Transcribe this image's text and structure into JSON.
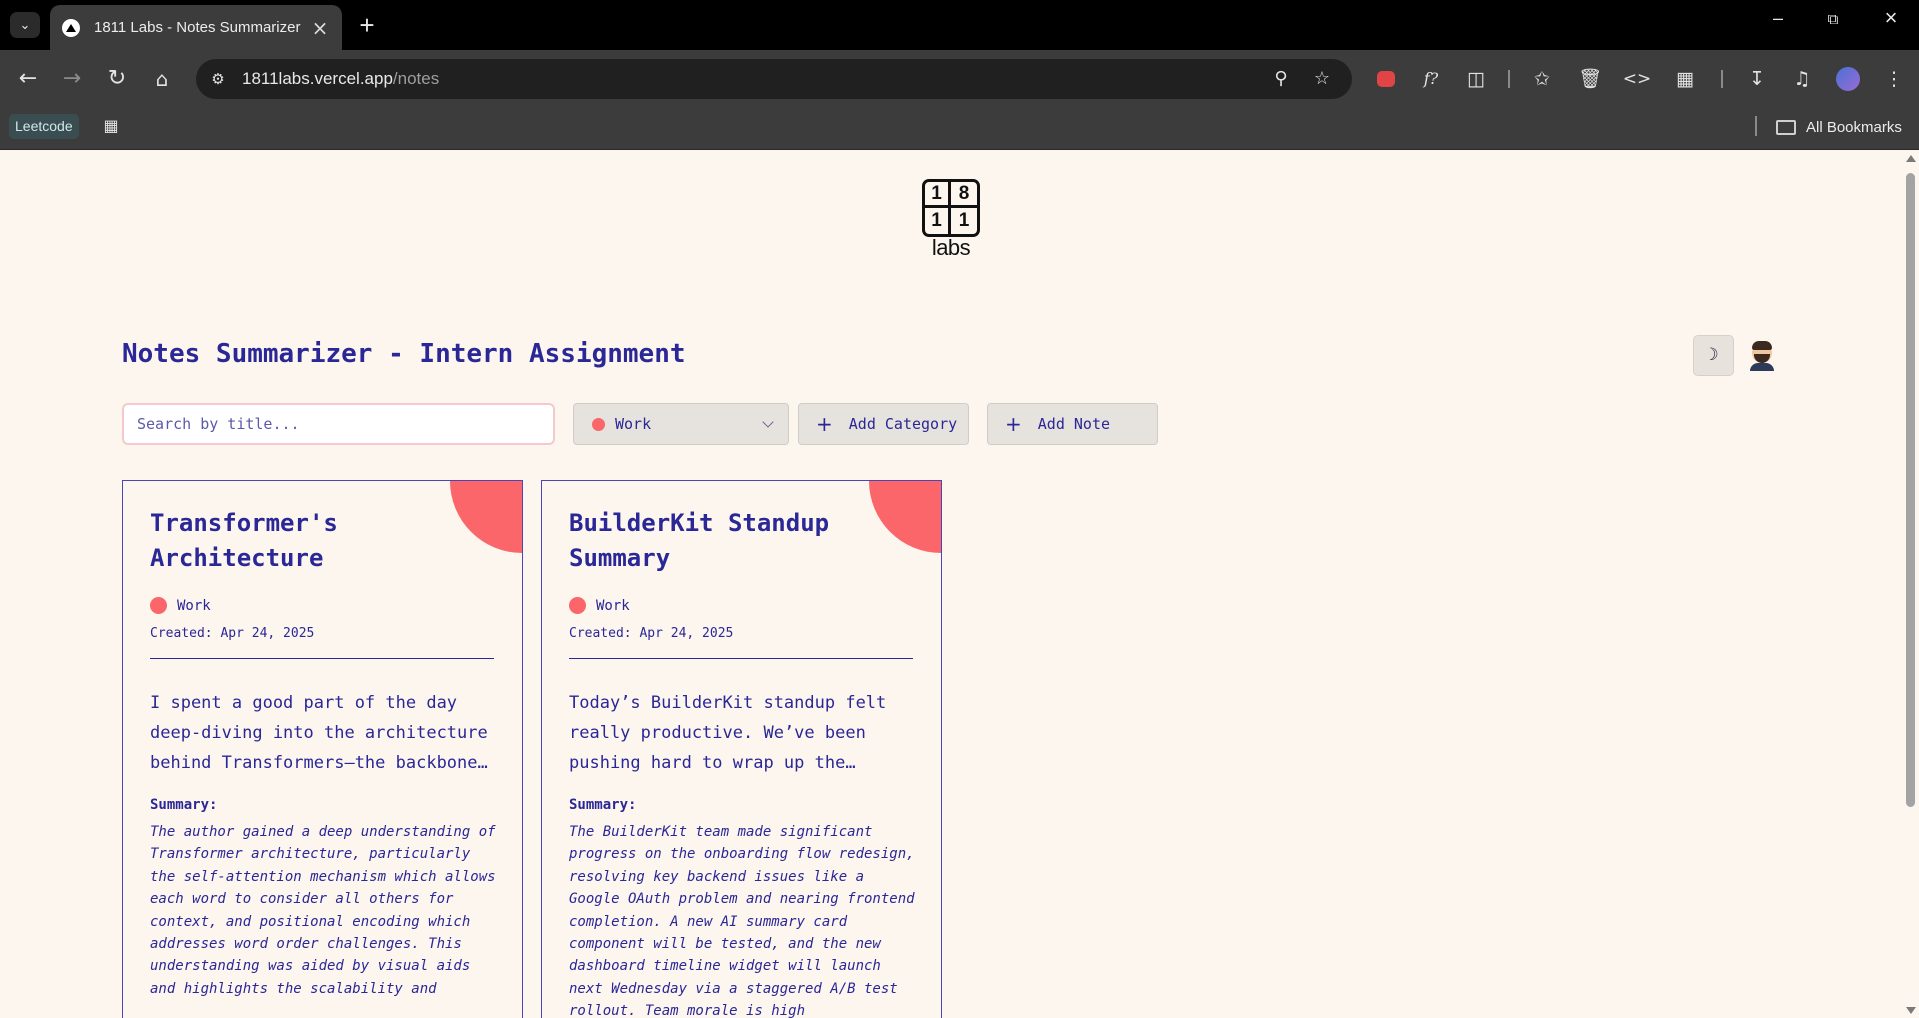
{
  "browser": {
    "tab_title": "1811 Labs - Notes Summarizer",
    "url_host": "1811labs.vercel.app",
    "url_path": "/notes",
    "bookmarks": {
      "leetcode": "Leetcode",
      "all": "All Bookmarks"
    }
  },
  "logo": {
    "digits": [
      "1",
      "8",
      "1",
      "1"
    ],
    "word": "labs"
  },
  "header": {
    "title": "Notes Summarizer - Intern Assignment"
  },
  "controls": {
    "search_placeholder": "Search by title...",
    "category_selected": "Work",
    "category_color": "#fa6669",
    "add_category": "Add Category",
    "add_note": "Add Note"
  },
  "notes": [
    {
      "title": "Transformer's Architecture",
      "category": "Work",
      "created": "Created: Apr 24, 2025",
      "body": "I spent a good part of the day deep-diving into the architecture behind Transformers—the backbone…",
      "summary_label": "Summary:",
      "summary": "The author gained a deep understanding of Transformer architecture, particularly the self-attention mechanism which allows each word to consider all others for context, and positional encoding which addresses word order challenges. This understanding was aided by visual aids and highlights the scalability and"
    },
    {
      "title": "BuilderKit Standup Summary",
      "category": "Work",
      "created": "Created: Apr 24, 2025",
      "body": "Today’s BuilderKit standup felt really productive. We’ve been pushing hard to wrap up the…",
      "summary_label": "Summary:",
      "summary": "The BuilderKit team made significant progress on the onboarding flow redesign, resolving key backend issues like a Google OAuth problem and nearing frontend completion. A new AI summary card component will be tested, and the new dashboard timeline widget will launch next Wednesday via a staggered A/B test rollout. Team morale is high"
    }
  ]
}
